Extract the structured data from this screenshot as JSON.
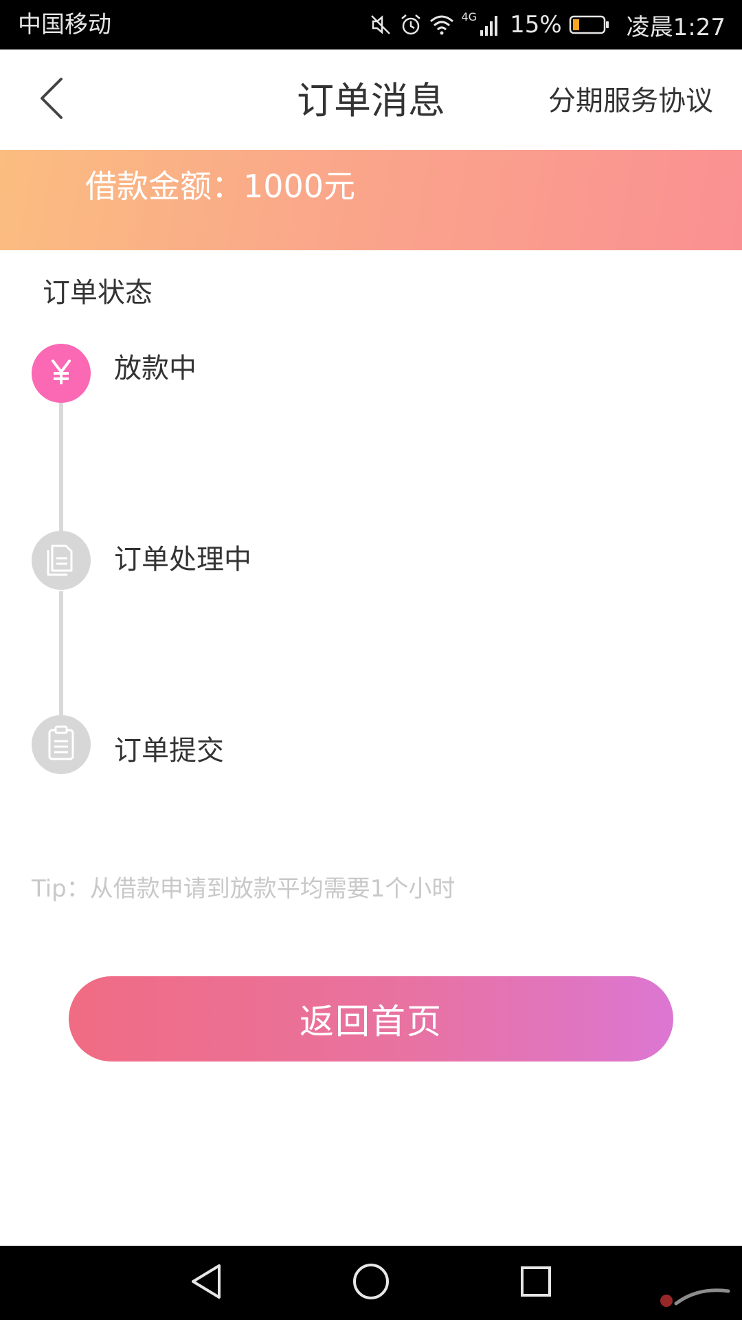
{
  "status_bar": {
    "carrier": "中国移动",
    "network": "4G",
    "battery_percent": "15%",
    "time": "凌晨1:27",
    "icons": [
      "mute-icon",
      "alarm-icon",
      "wifi-icon",
      "signal-icon",
      "battery-icon"
    ]
  },
  "nav": {
    "back_icon": "chevron-left-icon",
    "title": "订单消息",
    "agreement_link": "分期服务协议"
  },
  "banner": {
    "amount_text": "借款金额：1000元"
  },
  "order_status": {
    "section_title": "订单状态",
    "steps": [
      {
        "label": "放款中",
        "icon": "yen-icon",
        "state": "active"
      },
      {
        "label": "订单处理中",
        "icon": "documents-icon",
        "state": "inactive"
      },
      {
        "label": "订单提交",
        "icon": "clipboard-icon",
        "state": "inactive"
      }
    ]
  },
  "tip": {
    "text": "Tip：从借款申请到放款平均需要1个小时"
  },
  "home_button": {
    "label": "返回首页"
  },
  "system_nav": {
    "icons": [
      "back-triangle-icon",
      "home-circle-icon",
      "recents-square-icon"
    ]
  },
  "colors": {
    "banner_start": "#fbbd80",
    "banner_end": "#fa9092",
    "active_step": "#fb68b4",
    "inactive_step": "#d7d7d7",
    "button_start": "#f06c83",
    "button_end": "#dc76d2",
    "tip": "#c8c8c8"
  }
}
